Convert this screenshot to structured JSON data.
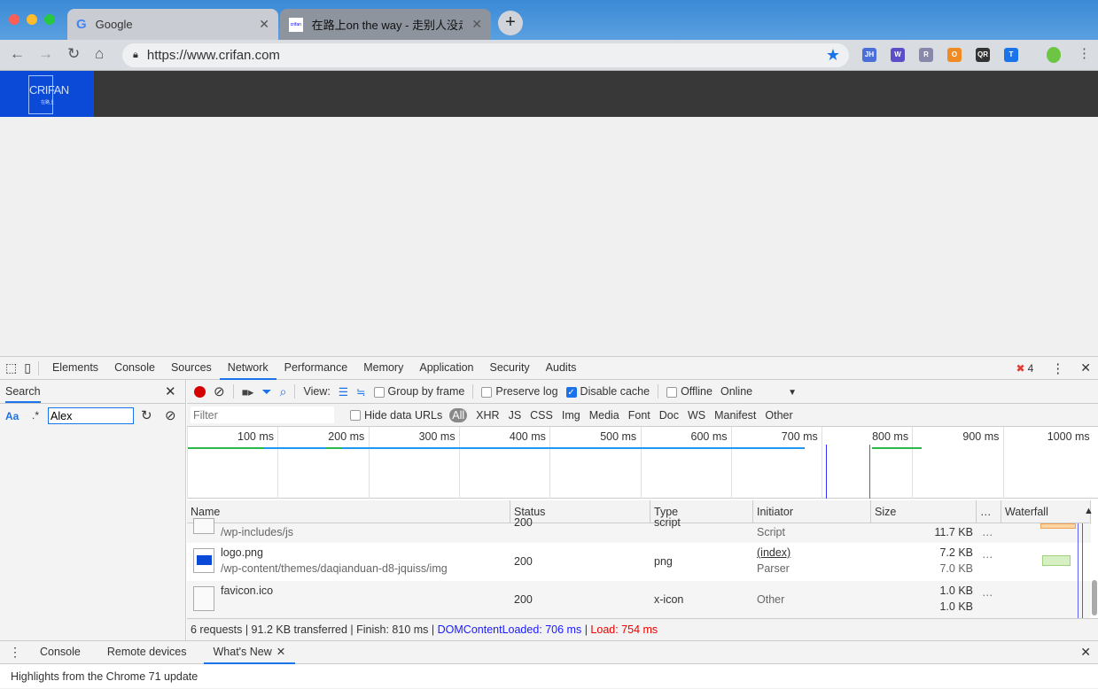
{
  "browser": {
    "tabs": [
      {
        "title": "Google",
        "active": false
      },
      {
        "title": "在路上on the way - 走别人没走",
        "active": true
      }
    ],
    "url": "https://www.crifan.com",
    "extensions": [
      {
        "label": "JH",
        "color": "#4a6fd8"
      },
      {
        "label": "W",
        "color": "#5b4fc8"
      },
      {
        "label": "R",
        "color": "#8888aa"
      },
      {
        "label": "O",
        "color": "#f08a24"
      },
      {
        "label": "QR",
        "color": "#333333"
      },
      {
        "label": "T",
        "color": "#1a73e8"
      }
    ]
  },
  "site": {
    "logo_text": "CRIFAN",
    "logo_sub": "在路上",
    "logo_color": "#0a4ad6"
  },
  "devtools": {
    "tabs": [
      "Elements",
      "Console",
      "Sources",
      "Network",
      "Performance",
      "Memory",
      "Application",
      "Security",
      "Audits"
    ],
    "active_tab": "Network",
    "error_count": "4",
    "search": {
      "title": "Search",
      "case_label": "Aa",
      "regex_label": ".*",
      "value": "Alex"
    },
    "network_toolbar": {
      "view_label": "View:",
      "group_by_frame": "Group by frame",
      "preserve_log": "Preserve log",
      "disable_cache": "Disable cache",
      "disable_cache_checked": true,
      "offline": "Offline",
      "throttle": "Online"
    },
    "filter": {
      "placeholder": "Filter",
      "hide_data_urls": "Hide data URLs",
      "types": [
        "All",
        "XHR",
        "JS",
        "CSS",
        "Img",
        "Media",
        "Font",
        "Doc",
        "WS",
        "Manifest",
        "Other"
      ],
      "active_type": "All"
    },
    "timeline_ticks": [
      "100 ms",
      "200 ms",
      "300 ms",
      "400 ms",
      "500 ms",
      "600 ms",
      "700 ms",
      "800 ms",
      "900 ms",
      "1000 ms"
    ],
    "columns": [
      "Name",
      "Status",
      "Type",
      "Initiator",
      "Size",
      "…",
      "Waterfall"
    ],
    "rows": [
      {
        "name": "",
        "path": "/wp-includes/js",
        "status": "200",
        "type": "script",
        "initiator": "",
        "initiator2": "Script",
        "size1": "",
        "size2": "11.7 KB",
        "icon": "js-file-icon"
      },
      {
        "name": "logo.png",
        "path": "/wp-content/themes/daqianduan-d8-jquiss/img",
        "status": "200",
        "type": "png",
        "initiator": "(index)",
        "initiator2": "Parser",
        "size1": "7.2 KB",
        "size2": "7.0 KB",
        "icon": "image-file-icon"
      },
      {
        "name": "favicon.ico",
        "path": "",
        "status": "200",
        "type": "x-icon",
        "initiator": "Other",
        "initiator2": "",
        "size1": "1.0 KB",
        "size2": "1.0 KB",
        "icon": "file-icon"
      }
    ],
    "status_bar": {
      "summary": "6 requests | 91.2 KB transferred | Finish: 810 ms | ",
      "dcl": "DOMContentLoaded: 706 ms",
      "sep": " | ",
      "load": "Load: 754 ms"
    },
    "drawer": {
      "tabs": [
        "Console",
        "Remote devices",
        "What's New"
      ],
      "active": "What's New",
      "content": "Highlights from the Chrome 71 update"
    }
  }
}
